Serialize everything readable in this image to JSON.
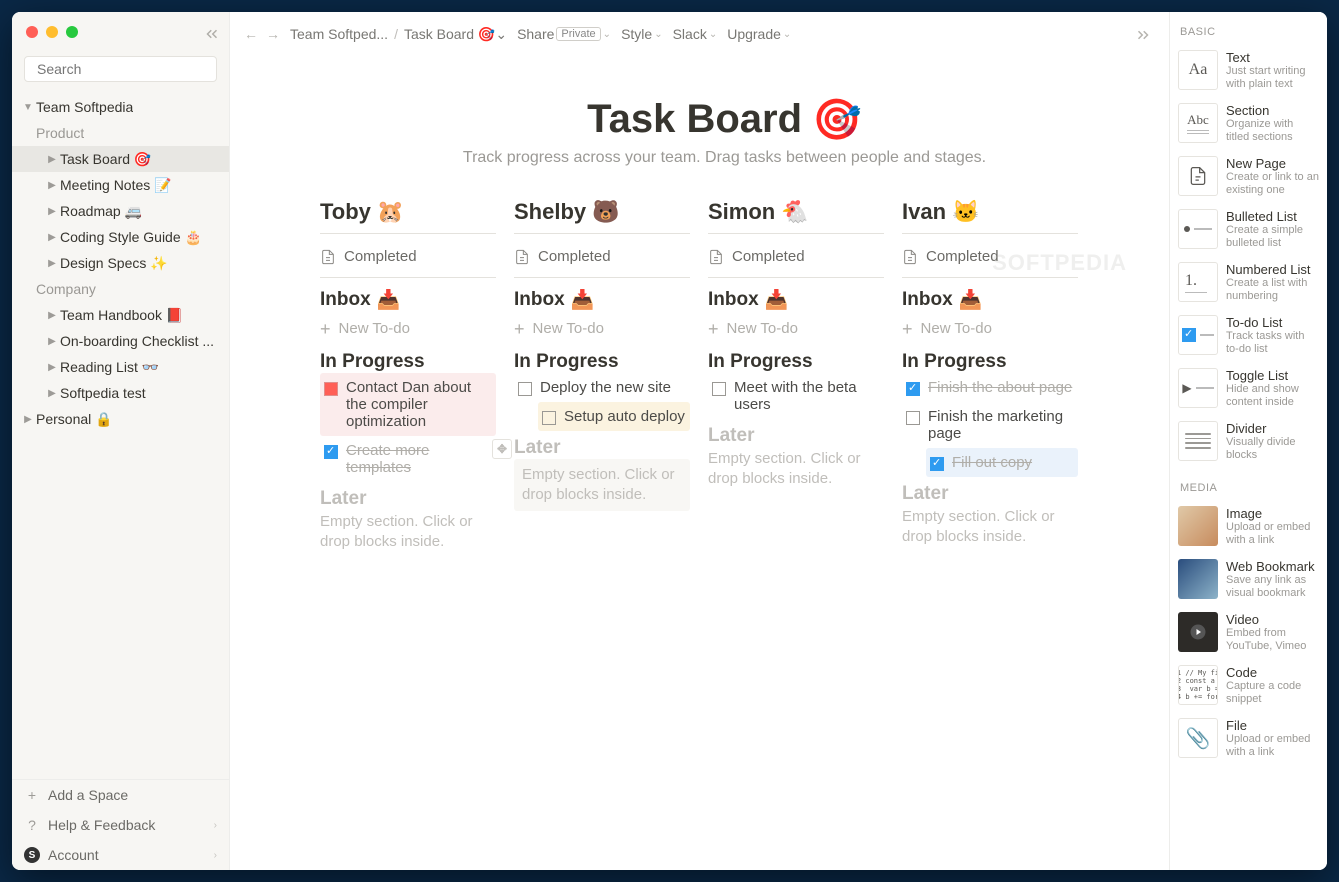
{
  "search_placeholder": "Search",
  "sidebar": {
    "root": "Team Softpedia",
    "groups": [
      {
        "label": "Product",
        "items": [
          {
            "label": "Task Board",
            "emoji": "🎯",
            "selected": true
          },
          {
            "label": "Meeting Notes",
            "emoji": "📝"
          },
          {
            "label": "Roadmap",
            "emoji": "🚐"
          },
          {
            "label": "Coding Style Guide",
            "emoji": "🎂"
          },
          {
            "label": "Design Specs",
            "emoji": "✨"
          }
        ]
      },
      {
        "label": "Company",
        "items": [
          {
            "label": "Team Handbook",
            "emoji": "📕"
          },
          {
            "label": "On-boarding Checklist ...",
            "emoji": ""
          },
          {
            "label": "Reading List",
            "emoji": "👓"
          },
          {
            "label": "Softpedia test",
            "emoji": ""
          }
        ]
      }
    ],
    "personal": {
      "label": "Personal",
      "emoji": "🔒"
    },
    "bottom": [
      {
        "icon": "+",
        "label": "Add a Space"
      },
      {
        "icon": "?",
        "label": "Help & Feedback",
        "chev": true
      },
      {
        "icon": "S",
        "label": "Account",
        "chev": true,
        "logo": true
      }
    ]
  },
  "top": {
    "crumb1": "Team Softped...",
    "crumb2": "Task Board",
    "crumb2_emoji": "🎯",
    "share": "Share",
    "share_badge": "Private",
    "style": "Style",
    "slack": "Slack",
    "upgrade": "Upgrade"
  },
  "page": {
    "title": "Task Board",
    "emoji": "🎯",
    "subtitle": "Track progress across your team.  Drag tasks between people and stages."
  },
  "board": {
    "completed": "Completed",
    "inbox": "Inbox",
    "inprog": "In Progress",
    "later": "Later",
    "newtodo": "New To-do",
    "empty": "Empty section. Click or drop blocks inside.",
    "cols": [
      {
        "name": "Toby",
        "emoji": "🐹",
        "inprog": [
          {
            "text": "Contact Dan about the compiler optimization",
            "hl": true,
            "red": true
          },
          {
            "text": "Create more templates",
            "done": true
          }
        ]
      },
      {
        "name": "Shelby",
        "emoji": "🐻",
        "drag": true,
        "later_empty_block": true,
        "inprog": [
          {
            "text": "Deploy the new site"
          },
          {
            "text": "Setup auto deploy",
            "sub": true
          }
        ]
      },
      {
        "name": "Simon",
        "emoji": "🐔",
        "inprog": [
          {
            "text": "Meet with the beta users"
          }
        ]
      },
      {
        "name": "Ivan",
        "emoji": "🐱",
        "inprog": [
          {
            "text": "Finish the about page",
            "done": true
          },
          {
            "text": "Finish the marketing page"
          },
          {
            "text": "Fill out copy",
            "done": true,
            "subsel": true
          }
        ]
      }
    ]
  },
  "right": {
    "basic": "BASIC",
    "media": "MEDIA",
    "basic_items": [
      {
        "icon": "Aa",
        "title": "Text",
        "desc": "Just start writing with plain text"
      },
      {
        "icon": "Abc",
        "title": "Section",
        "desc": "Organize with titled sections",
        "sub": "lines"
      },
      {
        "icon": "page",
        "title": "New Page",
        "desc": "Create or link to an existing one"
      },
      {
        "icon": "bul",
        "title": "Bulleted List",
        "desc": "Create a simple bulleted list"
      },
      {
        "icon": "1.",
        "title": "Numbered List",
        "desc": "Create a list with numbering",
        "sub": "lines"
      },
      {
        "icon": "todo",
        "title": "To-do List",
        "desc": "Track tasks with to-do list"
      },
      {
        "icon": "tog",
        "title": "Toggle List",
        "desc": "Hide and show content inside"
      },
      {
        "icon": "div",
        "title": "Divider",
        "desc": "Visually divide blocks"
      }
    ],
    "media_items": [
      {
        "icon": "img",
        "title": "Image",
        "desc": "Upload or embed with a link"
      },
      {
        "icon": "wave",
        "title": "Web Bookmark",
        "desc": "Save any link as visual bookmark"
      },
      {
        "icon": "vid",
        "title": "Video",
        "desc": "Embed from YouTube, Vimeo"
      },
      {
        "icon": "code",
        "title": "Code",
        "desc": "Capture a code snippet"
      },
      {
        "icon": "file",
        "title": "File",
        "desc": "Upload or embed with a link"
      }
    ]
  },
  "watermark": "SOFTPEDIA"
}
